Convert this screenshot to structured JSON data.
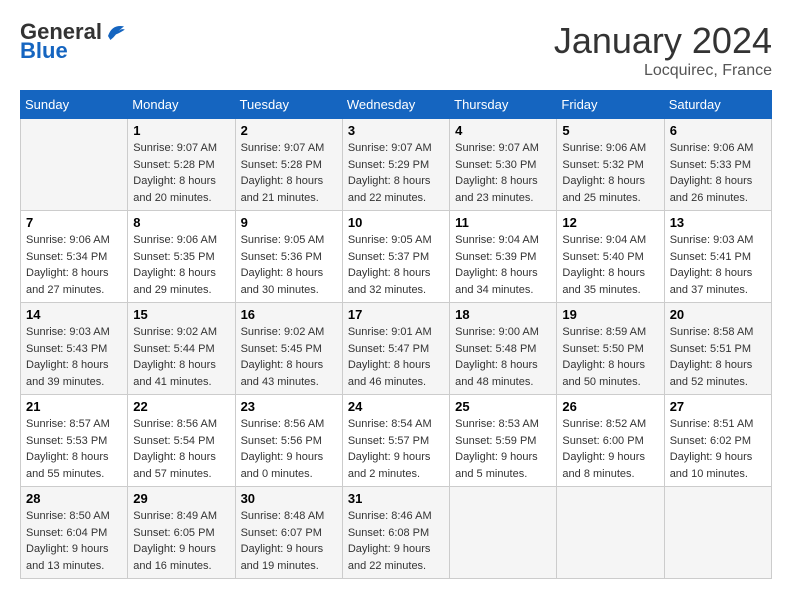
{
  "header": {
    "logo_general": "General",
    "logo_blue": "Blue",
    "month_title": "January 2024",
    "location": "Locquirec, France"
  },
  "days_of_week": [
    "Sunday",
    "Monday",
    "Tuesday",
    "Wednesday",
    "Thursday",
    "Friday",
    "Saturday"
  ],
  "weeks": [
    [
      {
        "day": "",
        "sunrise": "",
        "sunset": "",
        "daylight": ""
      },
      {
        "day": "1",
        "sunrise": "Sunrise: 9:07 AM",
        "sunset": "Sunset: 5:28 PM",
        "daylight": "Daylight: 8 hours and 20 minutes."
      },
      {
        "day": "2",
        "sunrise": "Sunrise: 9:07 AM",
        "sunset": "Sunset: 5:28 PM",
        "daylight": "Daylight: 8 hours and 21 minutes."
      },
      {
        "day": "3",
        "sunrise": "Sunrise: 9:07 AM",
        "sunset": "Sunset: 5:29 PM",
        "daylight": "Daylight: 8 hours and 22 minutes."
      },
      {
        "day": "4",
        "sunrise": "Sunrise: 9:07 AM",
        "sunset": "Sunset: 5:30 PM",
        "daylight": "Daylight: 8 hours and 23 minutes."
      },
      {
        "day": "5",
        "sunrise": "Sunrise: 9:06 AM",
        "sunset": "Sunset: 5:32 PM",
        "daylight": "Daylight: 8 hours and 25 minutes."
      },
      {
        "day": "6",
        "sunrise": "Sunrise: 9:06 AM",
        "sunset": "Sunset: 5:33 PM",
        "daylight": "Daylight: 8 hours and 26 minutes."
      }
    ],
    [
      {
        "day": "7",
        "sunrise": "Sunrise: 9:06 AM",
        "sunset": "Sunset: 5:34 PM",
        "daylight": "Daylight: 8 hours and 27 minutes."
      },
      {
        "day": "8",
        "sunrise": "Sunrise: 9:06 AM",
        "sunset": "Sunset: 5:35 PM",
        "daylight": "Daylight: 8 hours and 29 minutes."
      },
      {
        "day": "9",
        "sunrise": "Sunrise: 9:05 AM",
        "sunset": "Sunset: 5:36 PM",
        "daylight": "Daylight: 8 hours and 30 minutes."
      },
      {
        "day": "10",
        "sunrise": "Sunrise: 9:05 AM",
        "sunset": "Sunset: 5:37 PM",
        "daylight": "Daylight: 8 hours and 32 minutes."
      },
      {
        "day": "11",
        "sunrise": "Sunrise: 9:04 AM",
        "sunset": "Sunset: 5:39 PM",
        "daylight": "Daylight: 8 hours and 34 minutes."
      },
      {
        "day": "12",
        "sunrise": "Sunrise: 9:04 AM",
        "sunset": "Sunset: 5:40 PM",
        "daylight": "Daylight: 8 hours and 35 minutes."
      },
      {
        "day": "13",
        "sunrise": "Sunrise: 9:03 AM",
        "sunset": "Sunset: 5:41 PM",
        "daylight": "Daylight: 8 hours and 37 minutes."
      }
    ],
    [
      {
        "day": "14",
        "sunrise": "Sunrise: 9:03 AM",
        "sunset": "Sunset: 5:43 PM",
        "daylight": "Daylight: 8 hours and 39 minutes."
      },
      {
        "day": "15",
        "sunrise": "Sunrise: 9:02 AM",
        "sunset": "Sunset: 5:44 PM",
        "daylight": "Daylight: 8 hours and 41 minutes."
      },
      {
        "day": "16",
        "sunrise": "Sunrise: 9:02 AM",
        "sunset": "Sunset: 5:45 PM",
        "daylight": "Daylight: 8 hours and 43 minutes."
      },
      {
        "day": "17",
        "sunrise": "Sunrise: 9:01 AM",
        "sunset": "Sunset: 5:47 PM",
        "daylight": "Daylight: 8 hours and 46 minutes."
      },
      {
        "day": "18",
        "sunrise": "Sunrise: 9:00 AM",
        "sunset": "Sunset: 5:48 PM",
        "daylight": "Daylight: 8 hours and 48 minutes."
      },
      {
        "day": "19",
        "sunrise": "Sunrise: 8:59 AM",
        "sunset": "Sunset: 5:50 PM",
        "daylight": "Daylight: 8 hours and 50 minutes."
      },
      {
        "day": "20",
        "sunrise": "Sunrise: 8:58 AM",
        "sunset": "Sunset: 5:51 PM",
        "daylight": "Daylight: 8 hours and 52 minutes."
      }
    ],
    [
      {
        "day": "21",
        "sunrise": "Sunrise: 8:57 AM",
        "sunset": "Sunset: 5:53 PM",
        "daylight": "Daylight: 8 hours and 55 minutes."
      },
      {
        "day": "22",
        "sunrise": "Sunrise: 8:56 AM",
        "sunset": "Sunset: 5:54 PM",
        "daylight": "Daylight: 8 hours and 57 minutes."
      },
      {
        "day": "23",
        "sunrise": "Sunrise: 8:56 AM",
        "sunset": "Sunset: 5:56 PM",
        "daylight": "Daylight: 9 hours and 0 minutes."
      },
      {
        "day": "24",
        "sunrise": "Sunrise: 8:54 AM",
        "sunset": "Sunset: 5:57 PM",
        "daylight": "Daylight: 9 hours and 2 minutes."
      },
      {
        "day": "25",
        "sunrise": "Sunrise: 8:53 AM",
        "sunset": "Sunset: 5:59 PM",
        "daylight": "Daylight: 9 hours and 5 minutes."
      },
      {
        "day": "26",
        "sunrise": "Sunrise: 8:52 AM",
        "sunset": "Sunset: 6:00 PM",
        "daylight": "Daylight: 9 hours and 8 minutes."
      },
      {
        "day": "27",
        "sunrise": "Sunrise: 8:51 AM",
        "sunset": "Sunset: 6:02 PM",
        "daylight": "Daylight: 9 hours and 10 minutes."
      }
    ],
    [
      {
        "day": "28",
        "sunrise": "Sunrise: 8:50 AM",
        "sunset": "Sunset: 6:04 PM",
        "daylight": "Daylight: 9 hours and 13 minutes."
      },
      {
        "day": "29",
        "sunrise": "Sunrise: 8:49 AM",
        "sunset": "Sunset: 6:05 PM",
        "daylight": "Daylight: 9 hours and 16 minutes."
      },
      {
        "day": "30",
        "sunrise": "Sunrise: 8:48 AM",
        "sunset": "Sunset: 6:07 PM",
        "daylight": "Daylight: 9 hours and 19 minutes."
      },
      {
        "day": "31",
        "sunrise": "Sunrise: 8:46 AM",
        "sunset": "Sunset: 6:08 PM",
        "daylight": "Daylight: 9 hours and 22 minutes."
      },
      {
        "day": "",
        "sunrise": "",
        "sunset": "",
        "daylight": ""
      },
      {
        "day": "",
        "sunrise": "",
        "sunset": "",
        "daylight": ""
      },
      {
        "day": "",
        "sunrise": "",
        "sunset": "",
        "daylight": ""
      }
    ]
  ]
}
